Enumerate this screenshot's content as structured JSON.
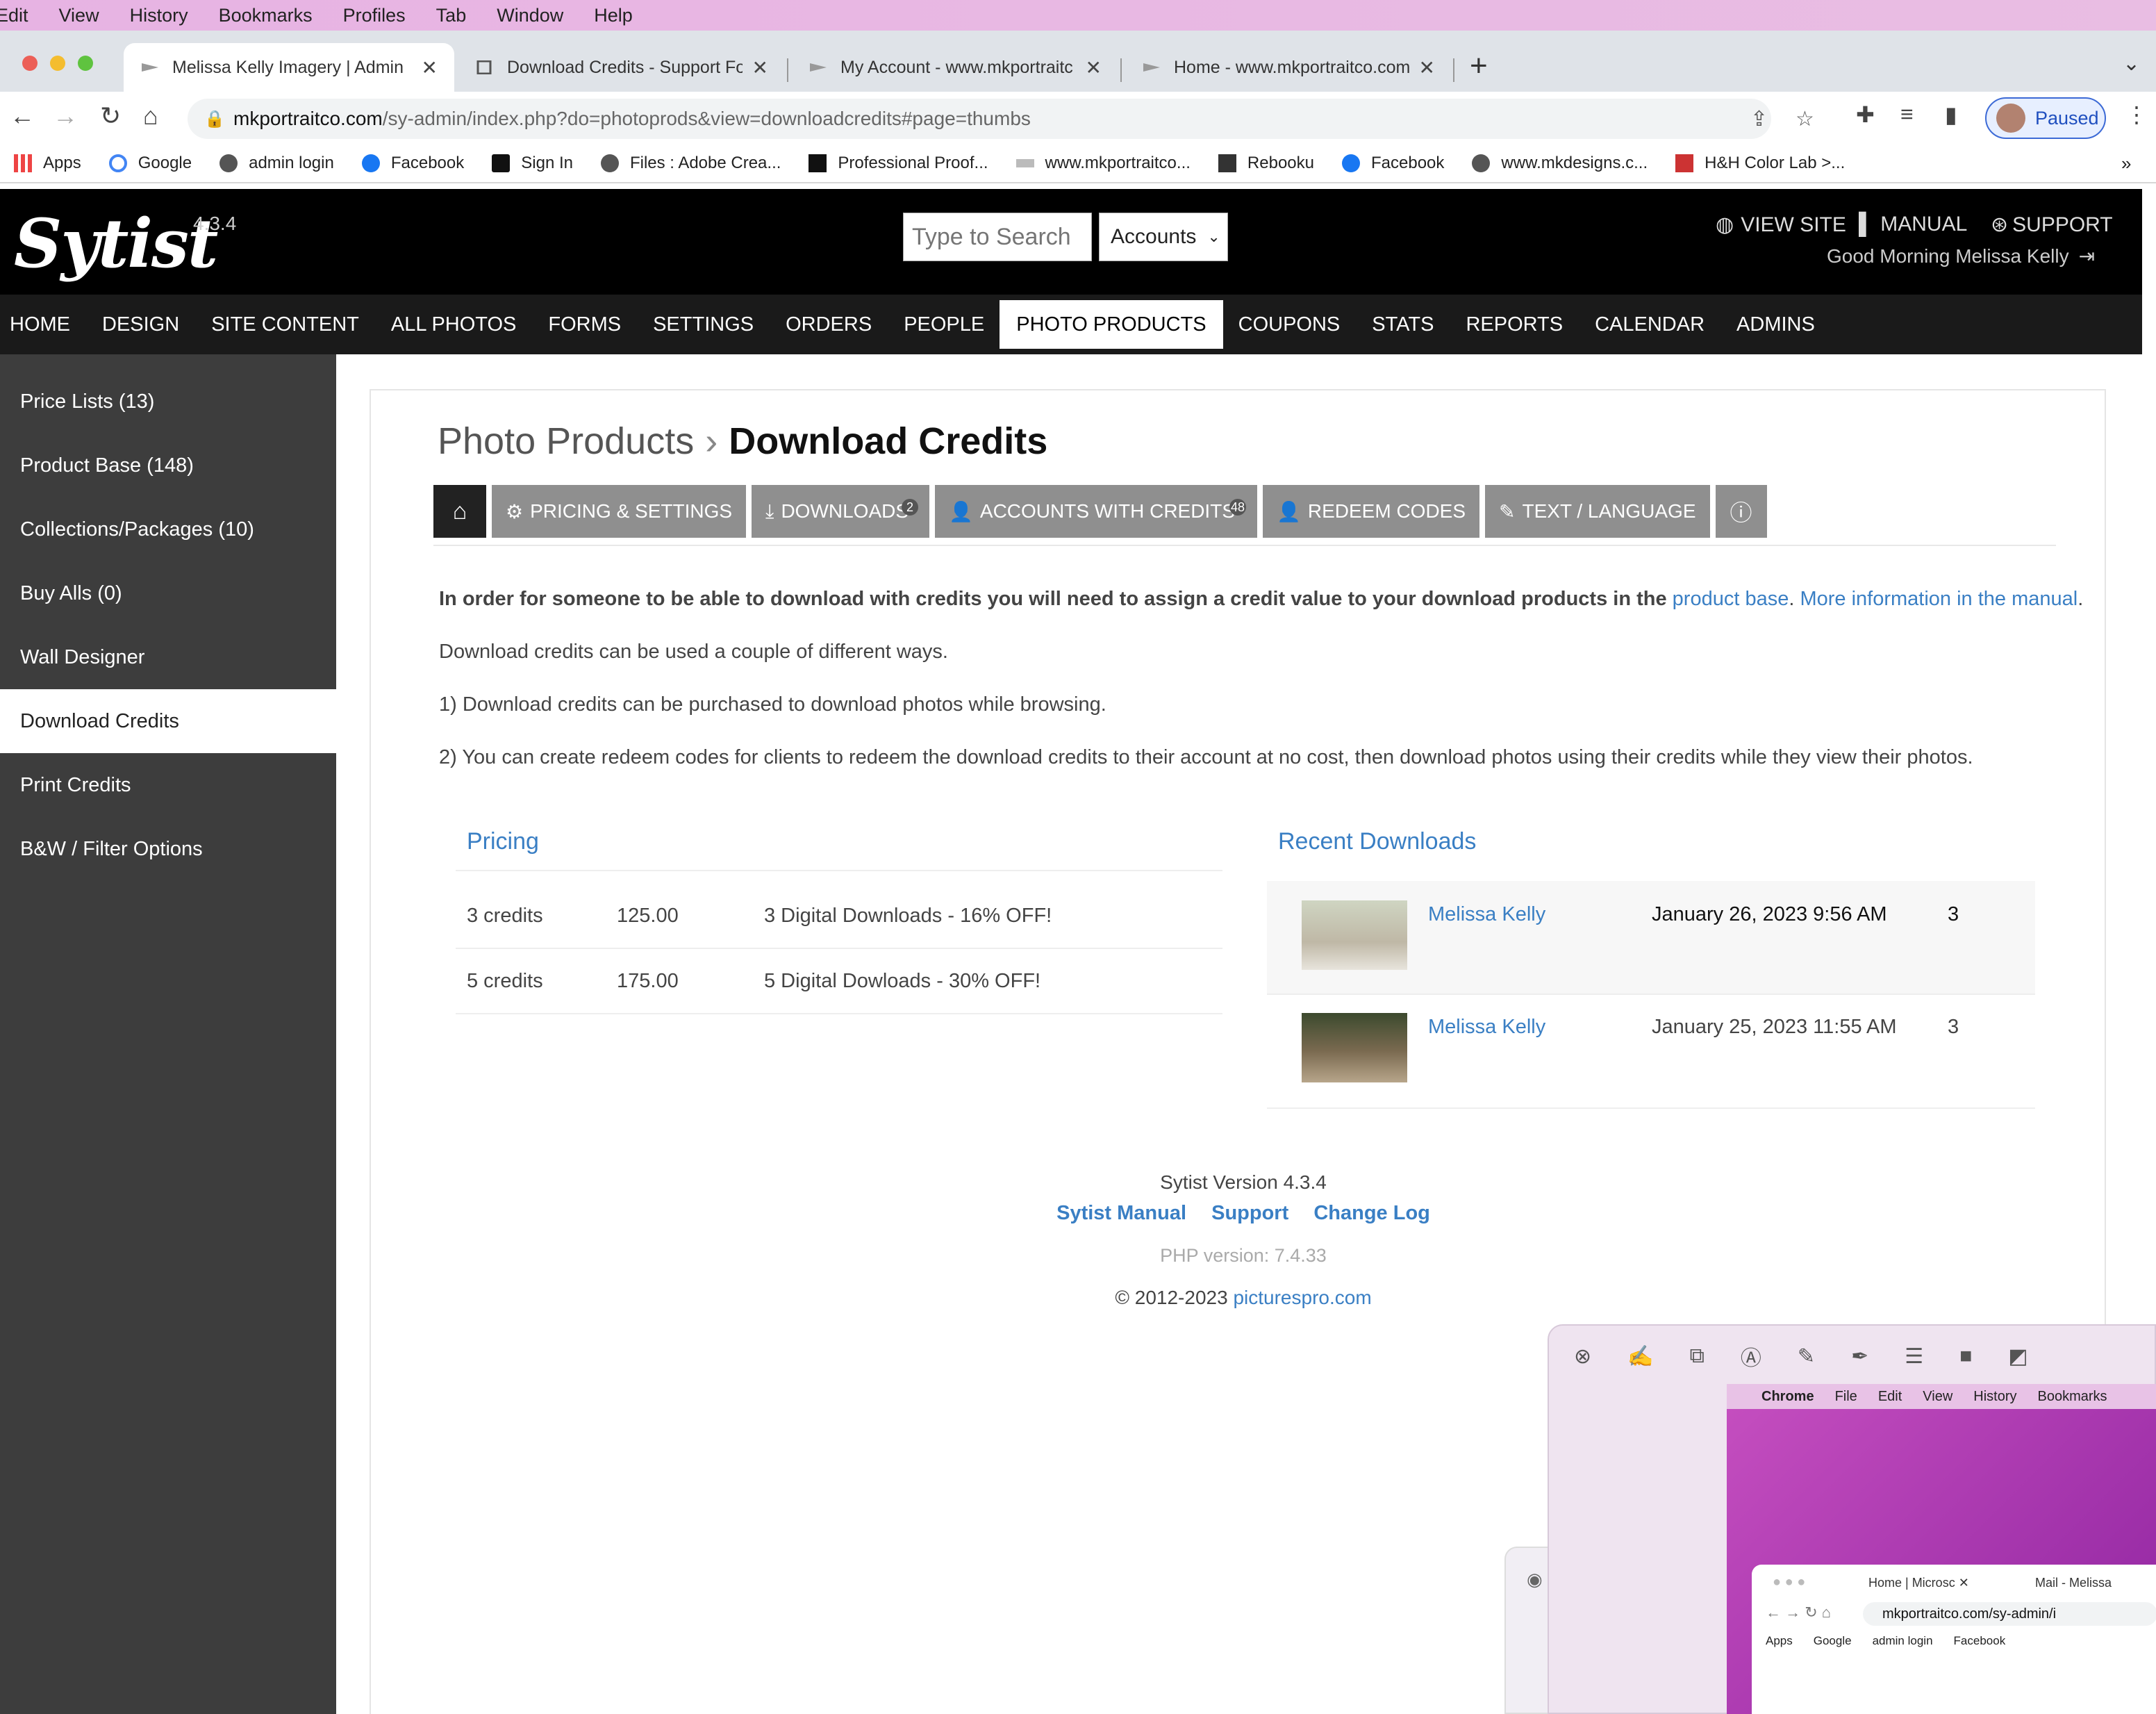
{
  "macos_menu": [
    "Edit",
    "View",
    "History",
    "Bookmarks",
    "Profiles",
    "Tab",
    "Window",
    "Help"
  ],
  "browser": {
    "tabs": [
      {
        "title": "Melissa Kelly Imagery | Admin",
        "active": true
      },
      {
        "title": "Download Credits - Support Fo"
      },
      {
        "title": "My Account - www.mkportraitc"
      },
      {
        "title": "Home - www.mkportraitco.com"
      }
    ],
    "url_host": "mkportraitco.com",
    "url_path": "/sy-admin/index.php?do=photoprods&view=downloadcredits#page=thumbs",
    "profile_status": "Paused",
    "bookmarks": [
      "Apps",
      "Google",
      "admin login",
      "Facebook",
      "Sign In",
      "Files : Adobe Crea...",
      "Professional Proof...",
      "www.mkportraitco...",
      "Rebooku",
      "Facebook",
      "www.mkdesigns.c...",
      "H&H Color Lab >..."
    ]
  },
  "header": {
    "logo": "Sytist",
    "version": "4.3.4",
    "search_placeholder": "Type to Search",
    "search_scope": "Accounts",
    "view_site": "VIEW SITE",
    "manual": "MANUAL",
    "support": "SUPPORT",
    "greeting": "Good Morning Melissa Kelly"
  },
  "main_nav": [
    "HOME",
    "DESIGN",
    "SITE CONTENT",
    "ALL PHOTOS",
    "FORMS",
    "SETTINGS",
    "ORDERS",
    "PEOPLE",
    "PHOTO PRODUCTS",
    "COUPONS",
    "STATS",
    "REPORTS",
    "CALENDAR",
    "ADMINS"
  ],
  "main_nav_active": "PHOTO PRODUCTS",
  "sidebar": [
    "Price Lists (13)",
    "Product Base (148)",
    "Collections/Packages (10)",
    "Buy Alls (0)",
    "Wall Designer",
    "Download Credits",
    "Print Credits",
    "B&W / Filter Options"
  ],
  "sidebar_active": "Download Credits",
  "breadcrumb": {
    "parent": "Photo Products",
    "current": "Download Credits"
  },
  "subtabs": [
    {
      "label": "PRICING & SETTINGS"
    },
    {
      "label": "DOWNLOADS",
      "badge": "2"
    },
    {
      "label": "ACCOUNTS WITH CREDITS",
      "badge": "48"
    },
    {
      "label": "REDEEM CODES"
    },
    {
      "label": "TEXT / LANGUAGE"
    }
  ],
  "intro": {
    "bold": "In order for someone to be able to download with credits you will need to assign a credit value to your download products in the",
    "link1": "product base",
    "dot": ".",
    "link2": "More information in the manual",
    "end": ".",
    "p2": "Download credits can be used a couple of different ways.",
    "p3": "1) Download credits can be purchased to download photos while browsing.",
    "p4": "2) You can create redeem codes for clients to redeem the download credits to their account at no cost, then download photos using their credits while they view their photos."
  },
  "pricing": {
    "title": "Pricing",
    "rows": [
      {
        "credits": "3 credits",
        "price": "125.00",
        "desc": "3 Digital Downloads - 16% OFF!"
      },
      {
        "credits": "5 credits",
        "price": "175.00",
        "desc": "5 Digital Dowloads - 30% OFF!"
      }
    ]
  },
  "recent": {
    "title": "Recent Downloads",
    "rows": [
      {
        "name": "Melissa Kelly",
        "date": "January 26, 2023 9:56 AM",
        "count": "3"
      },
      {
        "name": "Melissa Kelly",
        "date": "January 25, 2023 11:55 AM",
        "count": "3"
      }
    ]
  },
  "footer": {
    "version": "Sytist Version 4.3.4",
    "links": [
      "Sytist Manual",
      "Support",
      "Change Log"
    ],
    "php": "PHP version: 7.4.33",
    "copyright": "© 2012-2023",
    "site": "picturespro.com"
  },
  "overlay": {
    "menu": [
      "Chrome",
      "File",
      "Edit",
      "View",
      "History",
      "Bookmarks"
    ],
    "tabs": [
      "Home | Microsc",
      "Mail - Melissa"
    ],
    "url": "mkportraitco.com/sy-admin/i",
    "bookmarks": [
      "Apps",
      "Google",
      "admin login",
      "Facebook"
    ]
  },
  "colors": {
    "link": "#3a7fc4",
    "nav_bg": "#1a1a1a",
    "sidebar_bg": "#3d3d3d",
    "subtab_bg": "#8f8f8f"
  }
}
